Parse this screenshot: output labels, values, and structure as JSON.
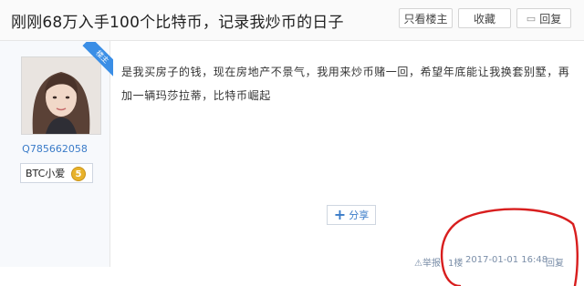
{
  "header": {
    "title": "刚刚68万入手100个比特币，记录我炒币的日子",
    "buttons": {
      "only_op": "只看楼主",
      "favorite": "收藏",
      "reply": "回复"
    }
  },
  "author": {
    "badge": "楼主",
    "user_id": "Q785662058",
    "nickname": "BTC小爱",
    "level": "5"
  },
  "post": {
    "text": "是我买房子的钱，现在房地产不景气，我用来炒币赌一回，希望年底能让我换套别墅，再加一辆玛莎拉蒂，比特币崛起",
    "share_label": "分享"
  },
  "footer": {
    "report": "⚠举报",
    "floor": "1楼",
    "time": "2017-01-01 16:48",
    "reply": "回复"
  },
  "colors": {
    "accent": "#3a7bc8",
    "badge": "#3a8ee6",
    "circle": "#d81e1e"
  }
}
